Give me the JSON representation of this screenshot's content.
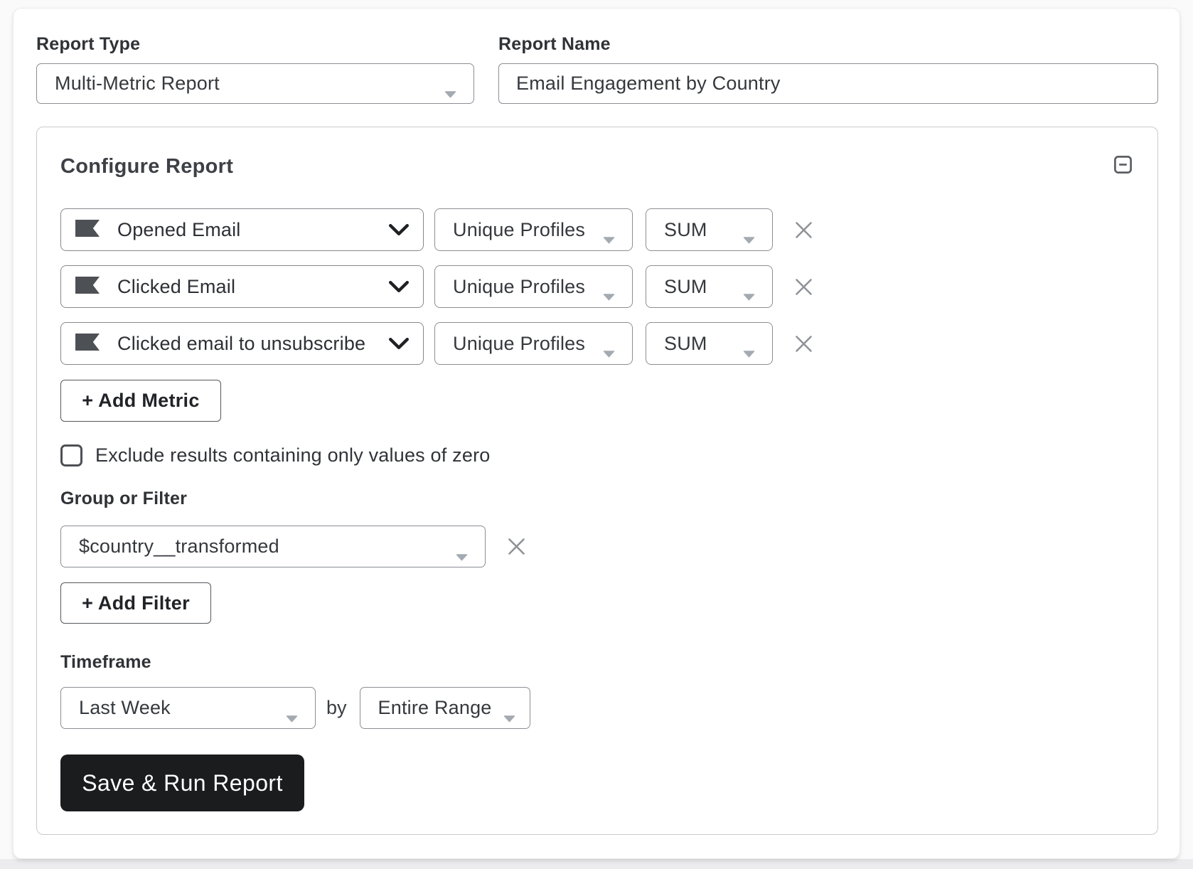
{
  "report_type": {
    "label": "Report Type",
    "value": "Multi-Metric Report"
  },
  "report_name": {
    "label": "Report Name",
    "value": "Email Engagement by Country"
  },
  "configure": {
    "title": "Configure Report",
    "collapse_icon": "minus-square",
    "metrics": [
      {
        "metric": "Opened Email",
        "measurement": "Unique Profiles",
        "aggregation": "SUM"
      },
      {
        "metric": "Clicked Email",
        "measurement": "Unique Profiles",
        "aggregation": "SUM"
      },
      {
        "metric": "Clicked email to unsubscribe",
        "measurement": "Unique Profiles",
        "aggregation": "SUM"
      }
    ],
    "add_metric_label": "+ Add Metric",
    "exclude_zero": {
      "label": "Exclude results containing only values of zero",
      "checked": false
    },
    "group_or_filter": {
      "label": "Group or Filter",
      "value": "$country__transformed",
      "add_filter_label": "+ Add Filter"
    },
    "timeframe": {
      "label": "Timeframe",
      "value": "Last Week",
      "by_label": "by",
      "interval_value": "Entire Range"
    },
    "save_button_label": "Save & Run Report"
  },
  "colors": {
    "accent_dark": "#1b1c1e",
    "icon_flag": "#4d5055",
    "border_gray": "#8b8e93"
  }
}
